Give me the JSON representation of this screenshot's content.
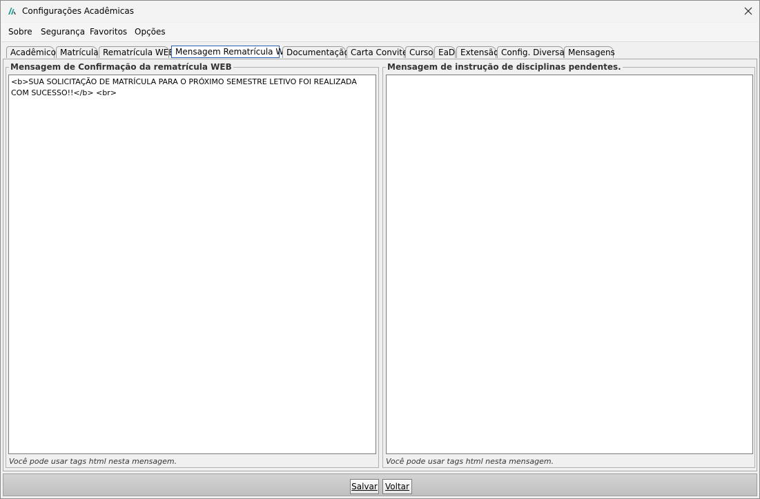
{
  "window": {
    "title": "Configurações Acadêmicas"
  },
  "menu": [
    "Sobre",
    "Segurança",
    "Favoritos",
    "Opções"
  ],
  "tabs": [
    {
      "label": "Acadêmico"
    },
    {
      "label": "Matrícula"
    },
    {
      "label": "Rematrícula WEB"
    },
    {
      "label": "Mensagem Rematrícula WEB",
      "active": true
    },
    {
      "label": "Documentação"
    },
    {
      "label": "Carta Convite"
    },
    {
      "label": "Curso"
    },
    {
      "label": "EaD"
    },
    {
      "label": "Extensão"
    },
    {
      "label": "Config. Diversas"
    },
    {
      "label": "Mensagens"
    }
  ],
  "left_group": {
    "title": "Mensagem de Confirmação da rematrícula WEB",
    "value": "<b>SUA SOLICITAÇÃO DE MATRÍCULA PARA O PRÓXIMO SEMESTRE LETIVO FOI REALIZADA COM SUCESSO!!</b> <br>",
    "hint": "Você pode usar tags html nesta mensagem."
  },
  "right_group": {
    "title": "Mensagem de instrução de disciplinas pendentes.",
    "value": "",
    "hint": "Você pode usar tags html nesta mensagem."
  },
  "footer": {
    "save_label": "Salvar",
    "back_label": "Voltar"
  },
  "colors": {
    "accent": "#2b5fb3",
    "logo": "#1a9a8a"
  }
}
